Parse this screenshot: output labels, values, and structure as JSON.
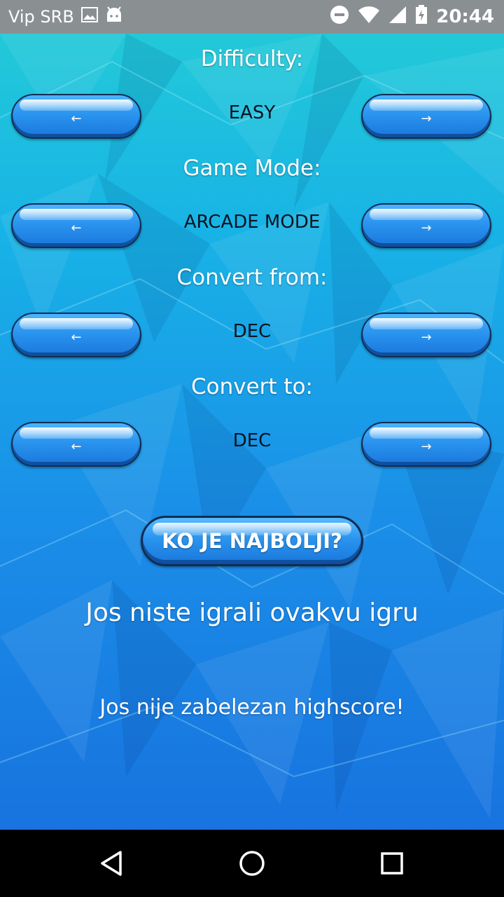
{
  "status_bar": {
    "carrier": "Vip SRB",
    "time": "20:44",
    "icons": [
      "image-icon",
      "android-icon",
      "do-not-disturb-icon",
      "wifi-icon",
      "signal-icon",
      "battery-charging-icon"
    ]
  },
  "settings": [
    {
      "label": "Difficulty:",
      "value": "EASY"
    },
    {
      "label": "Game Mode:",
      "value": "ARCADE MODE"
    },
    {
      "label": "Convert from:",
      "value": "DEC"
    },
    {
      "label": "Convert to:",
      "value": "DEC"
    }
  ],
  "arrows": {
    "prev": "←",
    "next": "→"
  },
  "leaderboard_button": "KO JE NAJBOLJI?",
  "messages": {
    "not_played": "Jos niste igrali ovakvu igru",
    "no_highscore": "Jos nije zabelezan highscore!"
  },
  "nav_bar": {
    "icons": [
      "back-icon",
      "home-icon",
      "recents-icon"
    ]
  },
  "colors": {
    "background_top": "#22c9d8",
    "background_bottom": "#1873df",
    "button": "#2a94ef"
  }
}
